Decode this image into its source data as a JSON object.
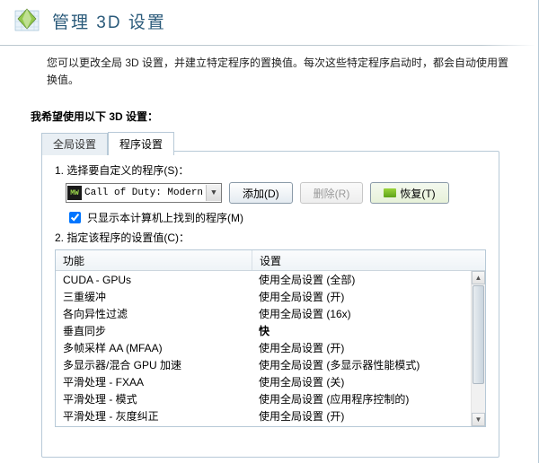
{
  "header": {
    "title": "管理 3D 设置"
  },
  "description": "您可以更改全局 3D 设置，并建立特定程序的置换值。每次这些特定程序启动时，都会自动使用置换值。",
  "section_label": "我希望使用以下 3D 设置：",
  "tabs": {
    "global": "全局设置",
    "program": "程序设置"
  },
  "step1": {
    "label": "1. 选择要自定义的程序(S)：",
    "program_badge": "MW",
    "program_name": "Call of Duty: Modern War...",
    "add_btn": "添加(D)",
    "remove_btn": "删除(R)",
    "restore_btn": "恢复(T)"
  },
  "checkbox_label": "只显示本计算机上找到的程序(M)",
  "step2_label": "2. 指定该程序的设置值(C)：",
  "grid": {
    "col_feature": "功能",
    "col_setting": "设置",
    "rows": [
      {
        "feature": "CUDA - GPUs",
        "setting": "使用全局设置 (全部)"
      },
      {
        "feature": "三重缓冲",
        "setting": "使用全局设置 (开)"
      },
      {
        "feature": "各向异性过滤",
        "setting": "使用全局设置 (16x)"
      },
      {
        "feature": "垂直同步",
        "setting": "快",
        "bold": true
      },
      {
        "feature": "多帧采样 AA (MFAA)",
        "setting": "使用全局设置 (开)"
      },
      {
        "feature": "多显示器/混合 GPU 加速",
        "setting": "使用全局设置 (多显示器性能模式)"
      },
      {
        "feature": "平滑处理 - FXAA",
        "setting": "使用全局设置 (关)"
      },
      {
        "feature": "平滑处理 - 模式",
        "setting": "使用全局设置 (应用程序控制的)"
      },
      {
        "feature": "平滑处理 - 灰度纠正",
        "setting": "使用全局设置 (开)"
      }
    ]
  }
}
